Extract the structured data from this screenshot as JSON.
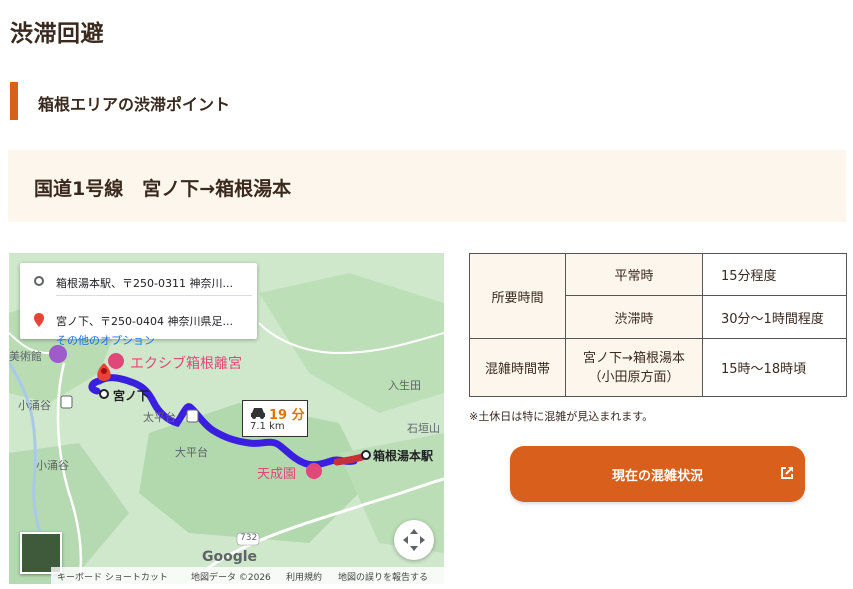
{
  "page": {
    "title": "渋滞回避",
    "subheading": "箱根エリアの渋滞ポイント",
    "route_heading": "国道1号線　宮ノ下→箱根湯本"
  },
  "map": {
    "directions": {
      "origin": "箱根湯本駅、〒250-0311 神奈川...",
      "destination": "宮ノ下、〒250-0404 神奈川県足...",
      "more_options": "その他のオプション"
    },
    "labels": {
      "museum": "美術館",
      "hotel_1": "エクシブ箱根離宮",
      "miyanoshita": "宮ノ下",
      "kowakudani": "小涌谷",
      "ikuta": "入生田",
      "taiheidai_station": "太平台",
      "ishigakiyama": "石垣山",
      "taiheidai": "大平台",
      "hakone_yumoto": "箱根湯本駅",
      "tenseien": "天成園",
      "kowakudani_2": "小涌谷",
      "route_732": "732"
    },
    "duration": {
      "time": "19 分",
      "distance": "7.1 km"
    },
    "attribution": "Google",
    "footer": {
      "shortcuts": "キーボード ショートカット",
      "map_data": "地図データ ©2026",
      "terms": "利用規約",
      "report": "地図の誤りを報告する"
    },
    "colors": {
      "route_blue": "#3a1fe0",
      "traffic_red": "#c6303b",
      "pin_red": "#ea4335"
    }
  },
  "table": {
    "row1_label": "所要時間",
    "normal_label": "平常時",
    "normal_value": "15分程度",
    "jam_label": "渋滞時",
    "jam_value": "30分〜1時間程度",
    "row2_label": "混雑時間帯",
    "direction": "宮ノ下→箱根湯本\n（小田原方面）",
    "time_value": "15時〜18時頃"
  },
  "note": "※土休日は特に混雑が見込まれます。",
  "cta": {
    "label": "現在の混雑状況",
    "icon": "external-link-icon"
  },
  "theme": {
    "accent": "#d9601c",
    "beige": "#fdf6ec"
  }
}
